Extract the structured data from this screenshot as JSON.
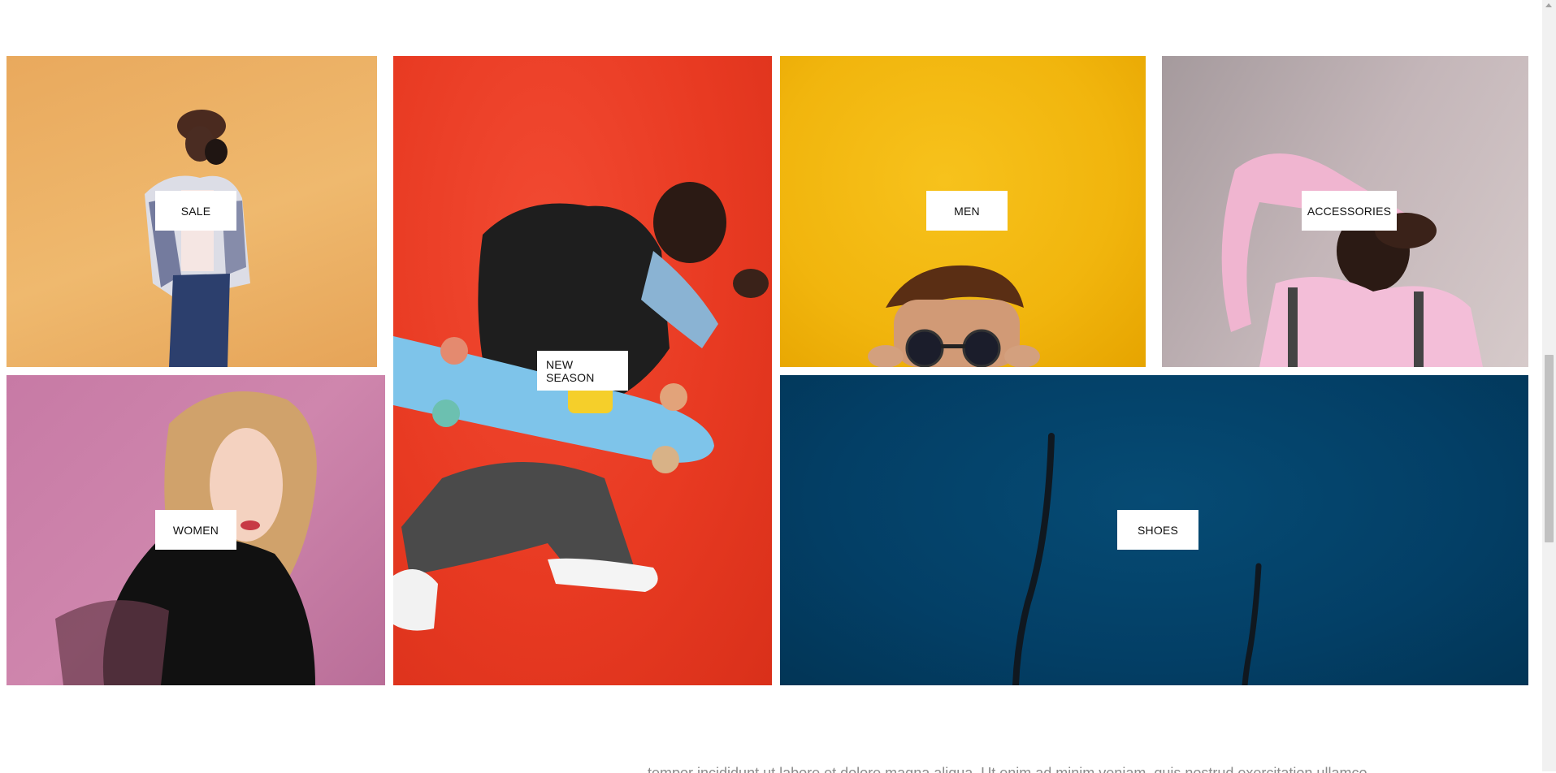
{
  "categories": {
    "sale": "SALE",
    "new_season": "NEW SEASON",
    "men": "MEN",
    "accessories": "ACCESSORIES",
    "women": "WOMEN",
    "shoes": "SHOES"
  },
  "footer_text": "tempor incididunt ut labore et dolore magna aliqua. Ut enim ad minim veniam, quis nostrud exercitation ullamco",
  "colors": {
    "sale_bg": "#eaa95e",
    "new_season_bg": "#e83a22",
    "men_bg": "#f1b50d",
    "accessories_bg": "#c4b6b9",
    "women_bg": "#c77aa5",
    "shoes_bg": "#033f66"
  }
}
